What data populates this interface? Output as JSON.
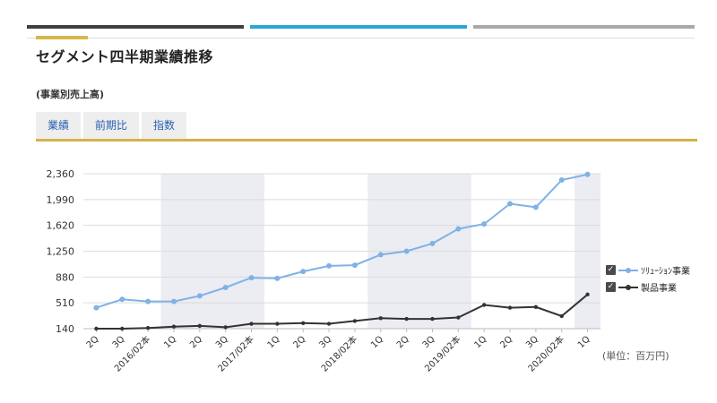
{
  "page": {
    "title": "セグメント四半期業績推移",
    "subtitle": "(事業別売上高)",
    "unit": "(単位：百万円)"
  },
  "tabs": [
    {
      "label": "業績",
      "active": true
    },
    {
      "label": "前期比",
      "active": false
    },
    {
      "label": "指数",
      "active": false
    }
  ],
  "colors": {
    "solution": "#7fb2e6",
    "product": "#333333",
    "shade": "#ececf3",
    "grid": "#dcdcdc",
    "tab_active": "#d4b24a"
  },
  "chart_data": {
    "type": "line",
    "categories": [
      "2Q",
      "3Q",
      "2016/02本",
      "1Q",
      "2Q",
      "3Q",
      "2017/02本",
      "1Q",
      "2Q",
      "3Q",
      "2018/02本",
      "1Q",
      "2Q",
      "3Q",
      "2019/02本",
      "1Q",
      "2Q",
      "3Q",
      "2020/02本",
      "1Q"
    ],
    "series": [
      {
        "name": "ｿﾘｭｰｼｮﾝ事業",
        "values": [
          440,
          560,
          530,
          530,
          610,
          730,
          870,
          860,
          960,
          1040,
          1050,
          1200,
          1250,
          1360,
          1570,
          1640,
          1930,
          1880,
          2270,
          2350
        ]
      },
      {
        "name": "製品事業",
        "values": [
          140,
          140,
          150,
          170,
          180,
          160,
          210,
          210,
          220,
          210,
          250,
          290,
          280,
          280,
          300,
          480,
          440,
          450,
          320,
          630
        ]
      }
    ],
    "yticks": [
      140,
      510,
      880,
      1250,
      1620,
      1990,
      2360
    ],
    "ylim": [
      140,
      2360
    ],
    "grid": true,
    "shaded_category_ranges": [
      [
        3,
        6
      ],
      [
        11,
        14
      ],
      [
        19,
        19
      ]
    ],
    "legend": {
      "position": "right",
      "checkboxes": [
        "✓",
        "✓"
      ]
    }
  }
}
